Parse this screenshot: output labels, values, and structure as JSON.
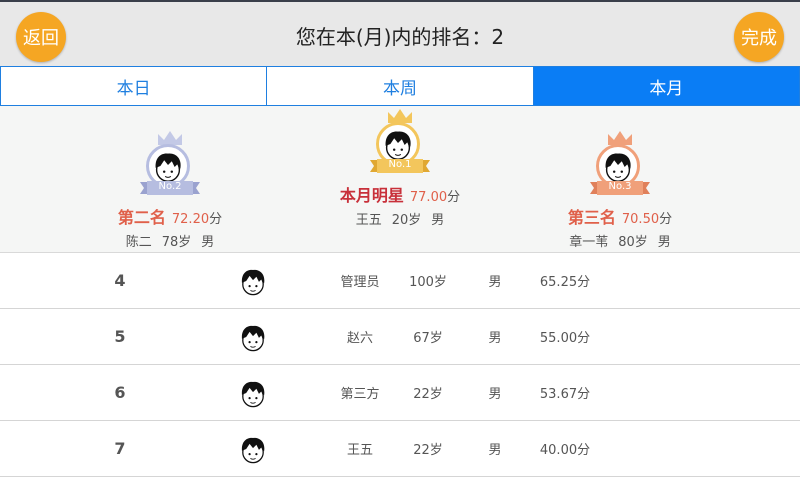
{
  "header": {
    "back_label": "返回",
    "title": "您在本(月)内的排名：2",
    "done_label": "完成"
  },
  "tabs": [
    {
      "label": "本日",
      "active": false
    },
    {
      "label": "本周",
      "active": false
    },
    {
      "label": "本月",
      "active": true
    }
  ],
  "podium": {
    "first": {
      "badge": "No.1",
      "title": "本月明星",
      "score": "77.00",
      "unit": "分",
      "name": "王五",
      "age": "20岁",
      "sex": "男",
      "color": "#f3c65c"
    },
    "second": {
      "badge": "No.2",
      "title": "第二名",
      "score": "72.20",
      "unit": "分",
      "name": "陈二",
      "age": "78岁",
      "sex": "男",
      "color": "#b6bde0"
    },
    "third": {
      "badge": "No.3",
      "title": "第三名",
      "score": "70.50",
      "unit": "分",
      "name": "章一苇",
      "age": "80岁",
      "sex": "男",
      "color": "#f0a07a"
    }
  },
  "rows": [
    {
      "rank": "4",
      "name": "管理员",
      "age": "100岁",
      "sex": "男",
      "score": "65.25分"
    },
    {
      "rank": "5",
      "name": "赵六",
      "age": "67岁",
      "sex": "男",
      "score": "55.00分"
    },
    {
      "rank": "6",
      "name": "第三方",
      "age": "22岁",
      "sex": "男",
      "score": "53.67分"
    },
    {
      "rank": "7",
      "name": "王五",
      "age": "22岁",
      "sex": "男",
      "score": "40.00分"
    }
  ],
  "colors": {
    "accent_orange": "#f5a623",
    "tab_blue": "#0a7df5",
    "title_red": "#c8303a",
    "score_red": "#e0604a"
  },
  "icons": {
    "avatar": "boy-avatar-icon",
    "crown": "crown-icon"
  }
}
